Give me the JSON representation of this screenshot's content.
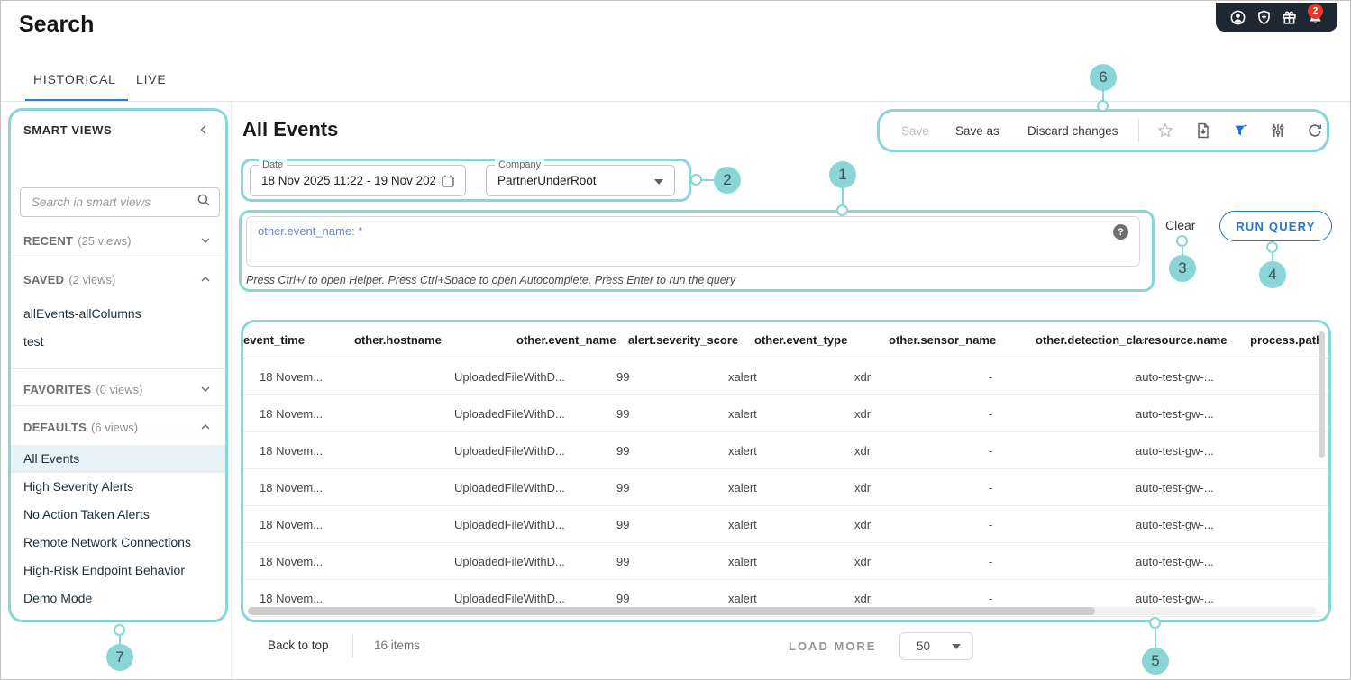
{
  "app": {
    "title": "Search"
  },
  "topbar": {
    "icons": [
      "user-icon",
      "shield-icon",
      "gift-icon",
      "bell-icon"
    ],
    "bell_badge": "2",
    "pill_color": "#1f2733",
    "badge_color": "#e8382e"
  },
  "tabs": [
    {
      "label": "HISTORICAL",
      "active": true
    },
    {
      "label": "LIVE",
      "active": false
    }
  ],
  "sidebar": {
    "title": "SMART VIEWS",
    "search_placeholder": "Search in smart views",
    "sections": [
      {
        "label": "RECENT",
        "count": "(25 views)",
        "expanded": false,
        "items": []
      },
      {
        "label": "SAVED",
        "count": "(2 views)",
        "expanded": true,
        "items": [
          {
            "label": "allEvents-allColumns"
          },
          {
            "label": "test"
          }
        ]
      },
      {
        "label": "FAVORITES",
        "count": "(0 views)",
        "expanded": false,
        "items": []
      },
      {
        "label": "DEFAULTS",
        "count": "(6 views)",
        "expanded": true,
        "items": [
          {
            "label": "All Events",
            "selected": true
          },
          {
            "label": "High Severity Alerts"
          },
          {
            "label": "No Action Taken Alerts"
          },
          {
            "label": "Remote Network Connections"
          },
          {
            "label": "High-Risk Endpoint Behavior"
          },
          {
            "label": "Demo Mode"
          }
        ]
      }
    ]
  },
  "main": {
    "title": "All Events",
    "filters": {
      "date": {
        "label": "Date",
        "value": "18 Nov 2025 11:22 - 19 Nov 202..."
      },
      "company": {
        "label": "Company",
        "value": "PartnerUnderRoot"
      }
    },
    "toolbar": {
      "save_label": "Save",
      "save_as_label": "Save as",
      "discard_label": "Discard changes",
      "icons": [
        "star-icon",
        "export-report-icon",
        "filter-icon",
        "columns-settings-icon",
        "refresh-icon"
      ],
      "filter_icon_color": "#1b6fd8"
    },
    "query": {
      "text": "other.event_name: *",
      "helper": "Press Ctrl+/ to open Helper. Press Ctrl+Space to open Autocomplete. Press Enter to run the query",
      "clear_label": "Clear",
      "run_label": "RUN QUERY"
    },
    "table": {
      "columns": [
        "event_time",
        "other.hostname",
        "other.event_name",
        "alert.severity_score",
        "other.event_type",
        "other.sensor_name",
        "other.detection_class",
        "resource.name",
        "process.path"
      ],
      "rows": [
        [
          "18 Novem...",
          "",
          "UploadedFileWithD...",
          "99",
          "xalert",
          "xdr",
          "-",
          "auto-test-gw-...",
          ""
        ],
        [
          "18 Novem...",
          "",
          "UploadedFileWithD...",
          "99",
          "xalert",
          "xdr",
          "-",
          "auto-test-gw-...",
          ""
        ],
        [
          "18 Novem...",
          "",
          "UploadedFileWithD...",
          "99",
          "xalert",
          "xdr",
          "-",
          "auto-test-gw-...",
          ""
        ],
        [
          "18 Novem...",
          "",
          "UploadedFileWithD...",
          "99",
          "xalert",
          "xdr",
          "-",
          "auto-test-gw-...",
          ""
        ],
        [
          "18 Novem...",
          "",
          "UploadedFileWithD...",
          "99",
          "xalert",
          "xdr",
          "-",
          "auto-test-gw-...",
          ""
        ],
        [
          "18 Novem...",
          "",
          "UploadedFileWithD...",
          "99",
          "xalert",
          "xdr",
          "-",
          "auto-test-gw-...",
          ""
        ],
        [
          "18 Novem...",
          "",
          "UploadedFileWithD...",
          "99",
          "xalert",
          "xdr",
          "-",
          "auto-test-gw-...",
          ""
        ]
      ]
    },
    "footer": {
      "back_to_top": "Back to top",
      "items_count": "16 items",
      "load_more": "LOAD MORE",
      "page_size": "50"
    }
  },
  "annotations": {
    "color": "#8ad5d6",
    "callouts": [
      {
        "number": "1"
      },
      {
        "number": "2"
      },
      {
        "number": "3"
      },
      {
        "number": "4"
      },
      {
        "number": "5"
      },
      {
        "number": "6"
      },
      {
        "number": "7"
      }
    ]
  }
}
